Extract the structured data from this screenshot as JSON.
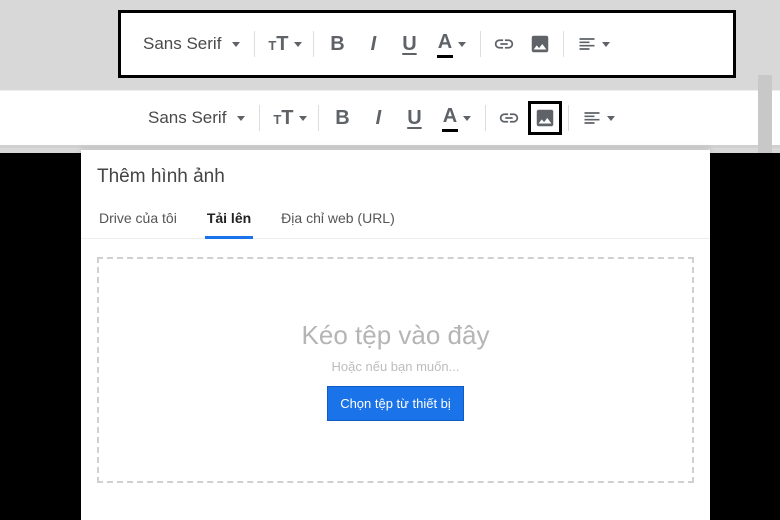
{
  "toolbar": {
    "font_label": "Sans Serif",
    "bold": "B",
    "italic": "I",
    "underline": "U",
    "text_color": "A"
  },
  "dialog": {
    "title": "Thêm hình ảnh",
    "tabs": {
      "my_drive": "Drive của tôi",
      "upload": "Tải lên",
      "url": "Địa chỉ web (URL)"
    },
    "dropzone": {
      "main": "Kéo tệp vào đây",
      "sub": "Hoặc nếu bạn muốn...",
      "button": "Chọn tệp từ thiết bị"
    }
  }
}
